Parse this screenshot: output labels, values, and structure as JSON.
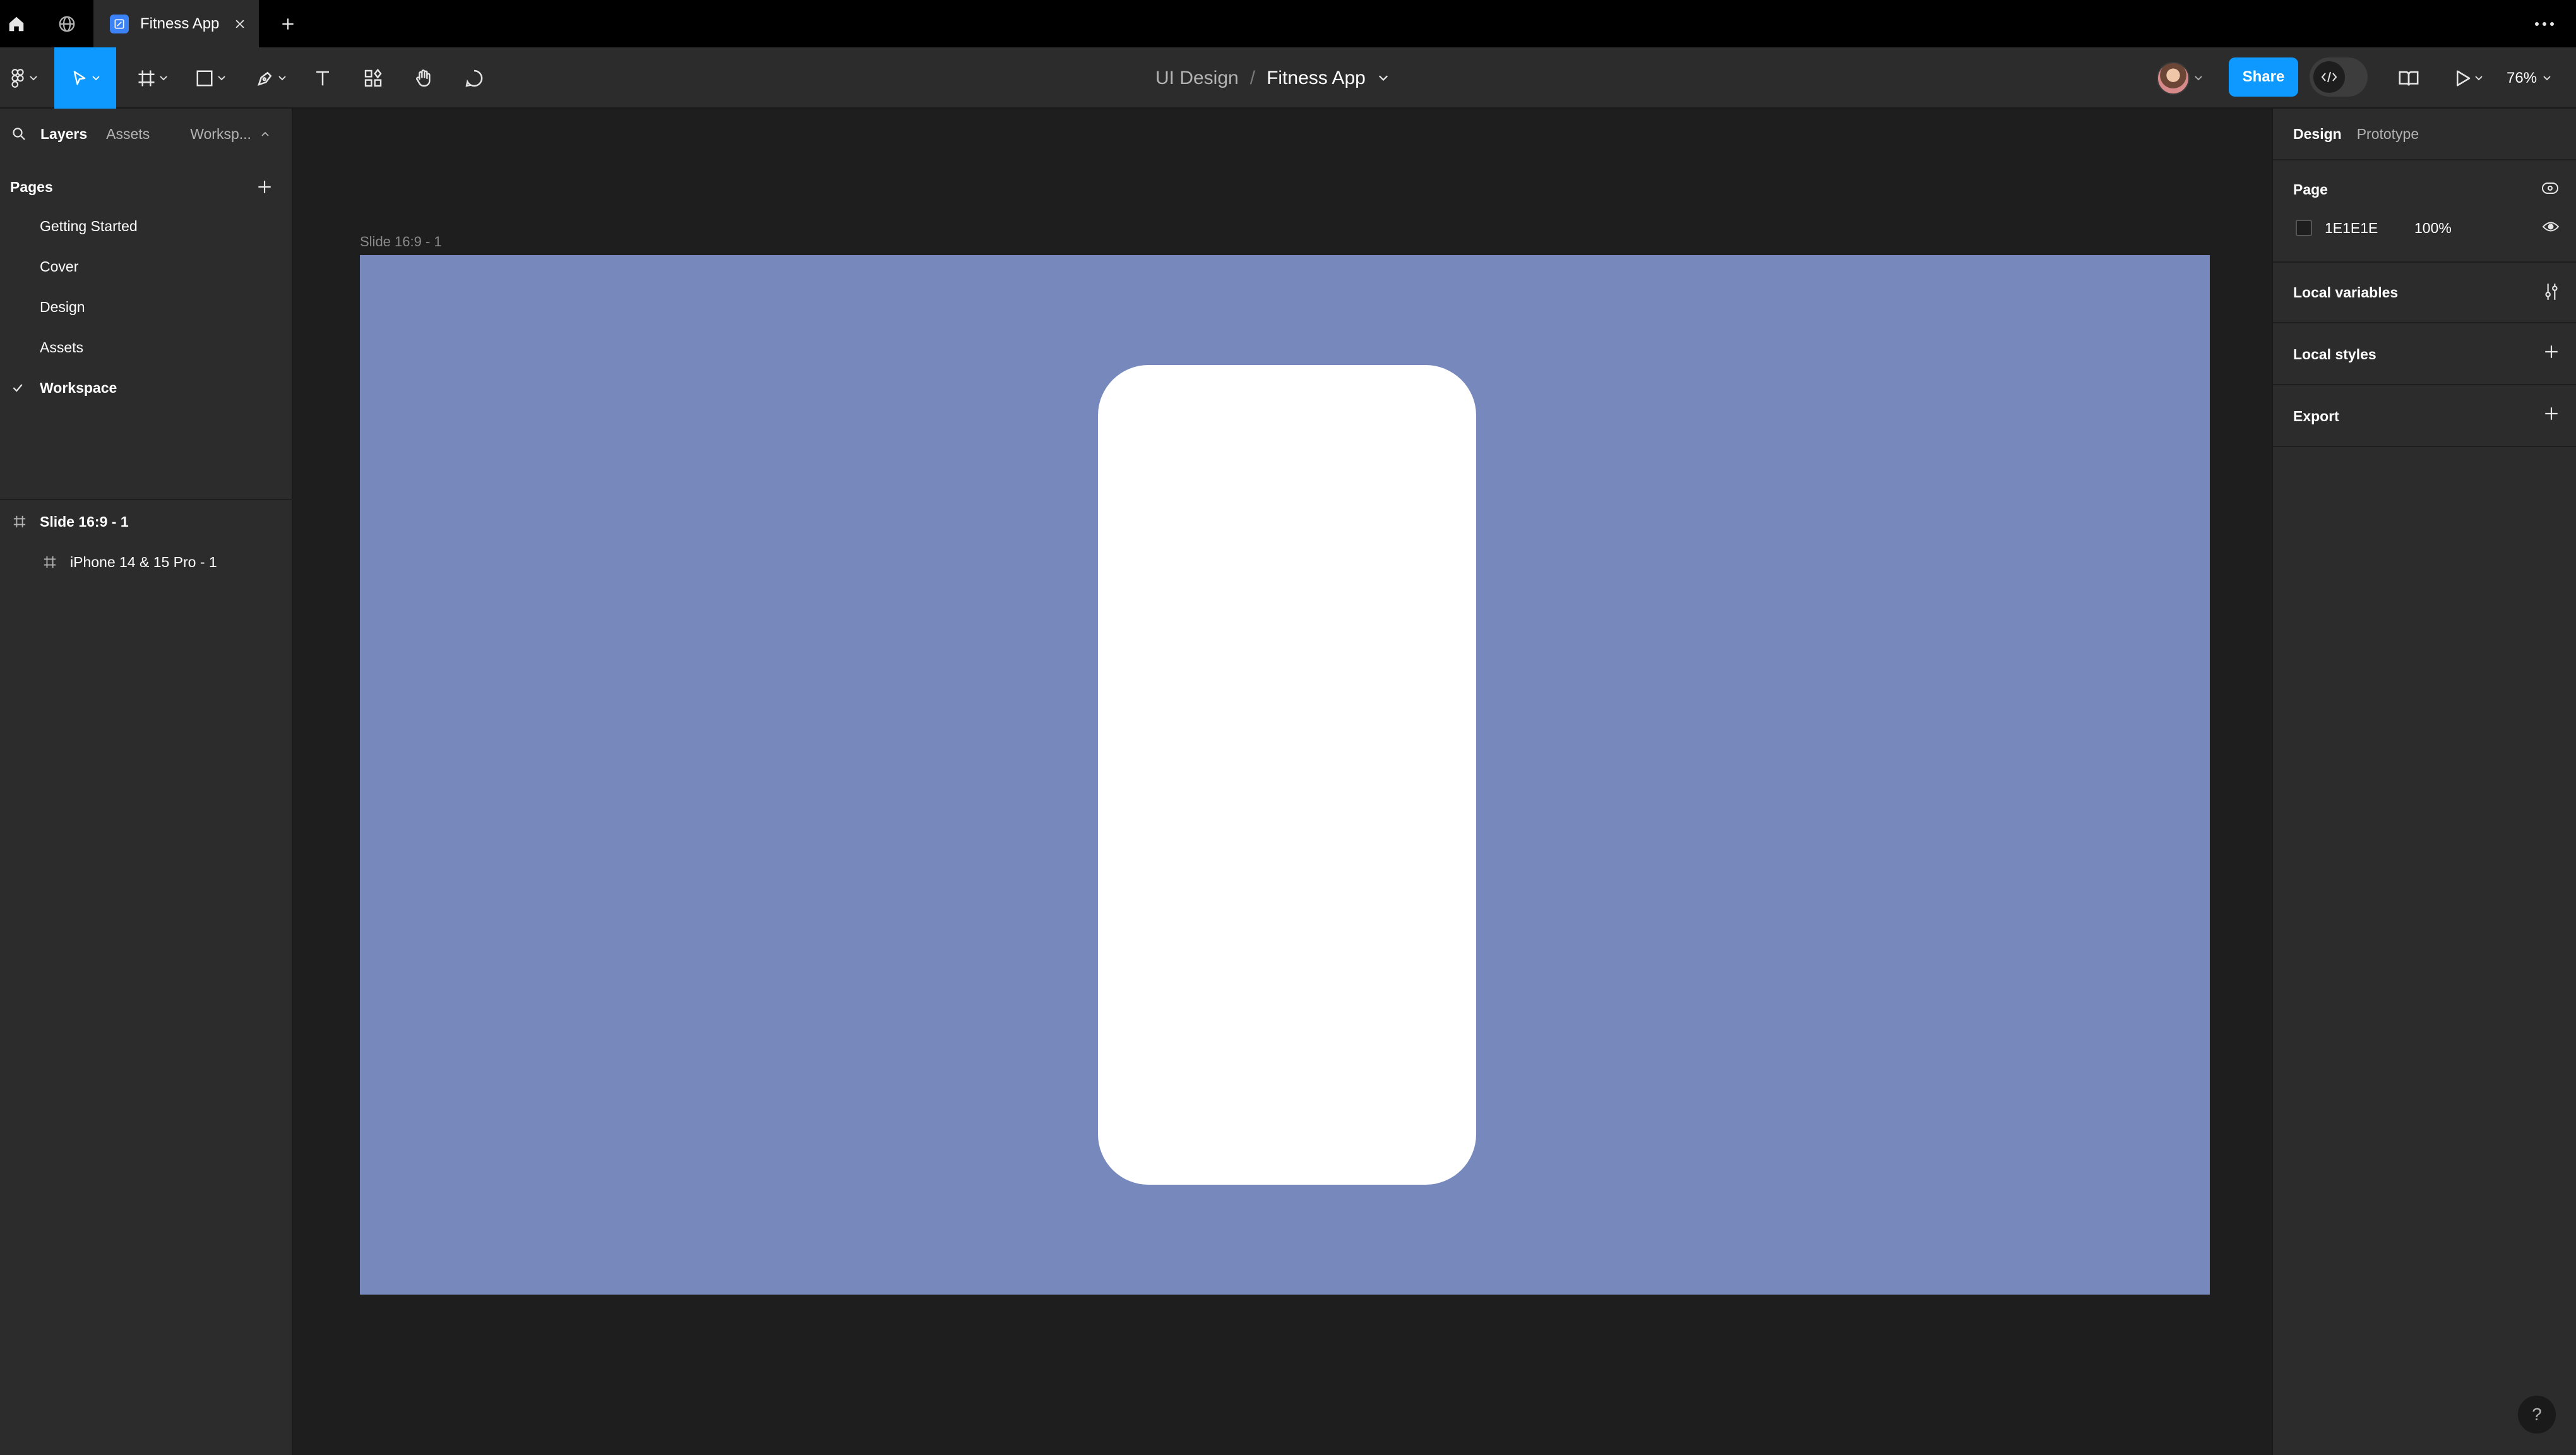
{
  "titlebar": {
    "tab_label": "Fitness App"
  },
  "toolbar": {
    "breadcrumb_project": "UI Design",
    "breadcrumb_sep": "/",
    "breadcrumb_file": "Fitness App",
    "share_label": "Share",
    "zoom_label": "76%",
    "accent_color": "#0d99ff"
  },
  "left_panel": {
    "tabs": [
      "Layers",
      "Assets",
      "Worksp..."
    ],
    "pages_title": "Pages",
    "pages": [
      "Getting Started",
      "Cover",
      "Design",
      "Assets",
      "Workspace"
    ],
    "selected_page": "Workspace",
    "layers": [
      "Slide 16:9 - 1",
      "iPhone 14 & 15 Pro - 1"
    ]
  },
  "canvas": {
    "frame_label": "Slide 16:9 - 1",
    "slide_color": "#7788bd",
    "phone_color": "#ffffff"
  },
  "right_panel": {
    "tabs": [
      "Design",
      "Prototype"
    ],
    "page_section": "Page",
    "page_color_hex": "1E1E1E",
    "page_opacity": "100%",
    "local_variables": "Local variables",
    "local_styles": "Local styles",
    "export": "Export"
  },
  "help_label": "?"
}
